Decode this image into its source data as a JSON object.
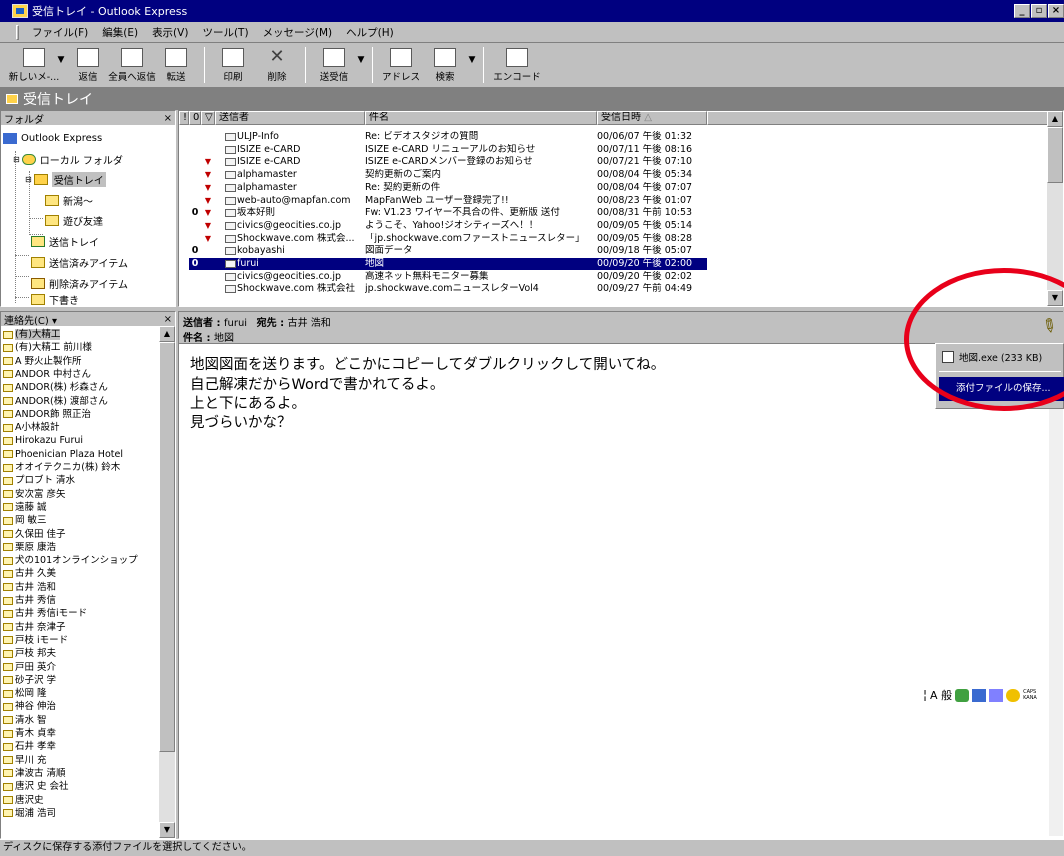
{
  "window": {
    "title": "受信トレイ - Outlook Express",
    "buttons": [
      "_",
      "▫",
      "×"
    ]
  },
  "menu": [
    "ファイル(F)",
    "編集(E)",
    "表示(V)",
    "ツール(T)",
    "メッセージ(M)",
    "ヘルプ(H)"
  ],
  "toolbar": {
    "new_mail": "新しいメ-...",
    "reply": "返信",
    "reply_all": "全員へ返信",
    "forward": "転送",
    "print": "印刷",
    "delete": "削除",
    "send_receive": "送受信",
    "address": "アドレス",
    "find": "検索",
    "encode": "エンコード"
  },
  "banner": {
    "title": "受信トレイ"
  },
  "folder_pane": {
    "header": "フォルダ",
    "close": "×",
    "items": [
      {
        "label": "Outlook Express",
        "icon": "outlook-icon"
      },
      {
        "label": "ローカル フォルダ",
        "icon": "globe-folder-icon"
      },
      {
        "label": "受信トレイ",
        "icon": "inbox-icon"
      },
      {
        "label": "新潟～",
        "icon": "folder-icon"
      },
      {
        "label": "遊び友達",
        "icon": "folder-icon"
      },
      {
        "label": "送信トレイ",
        "icon": "outbox-icon"
      },
      {
        "label": "送信済みアイテム",
        "icon": "sent-icon"
      },
      {
        "label": "削除済みアイテム",
        "icon": "trash-icon"
      },
      {
        "label": "下書き",
        "icon": "drafts-icon"
      }
    ]
  },
  "message_list": {
    "columns": {
      "priority": "!",
      "attach": "0",
      "flag": "▽",
      "from": "送信者",
      "subject": "件名",
      "received": "受信日時"
    },
    "rows": [
      {
        "attach": "",
        "flag": "",
        "from": "ULJP-Info",
        "subject": "Re: ビデオスタジオの質問",
        "date": "00/06/07 午後 01:32"
      },
      {
        "attach": "",
        "flag": "",
        "from": "ISIZE e-CARD",
        "subject": "ISIZE e-CARD リニューアルのお知らせ",
        "date": "00/07/11 午後 08:16"
      },
      {
        "attach": "",
        "flag": "▼",
        "from": "ISIZE e-CARD",
        "subject": "ISIZE e-CARDメンバー登録のお知らせ",
        "date": "00/07/21 午後 07:10"
      },
      {
        "attach": "",
        "flag": "▼",
        "from": "alphamaster",
        "subject": "契約更新のご案内",
        "date": "00/08/04 午後 05:34"
      },
      {
        "attach": "",
        "flag": "▼",
        "from": "alphamaster",
        "subject": "Re: 契約更新の件",
        "date": "00/08/04 午後 07:07"
      },
      {
        "attach": "",
        "flag": "▼",
        "from": "web-auto@mapfan.com",
        "subject": "MapFanWeb ユーザー登録完了!!",
        "date": "00/08/23 午後 01:07"
      },
      {
        "attach": "0",
        "flag": "▼",
        "from": "坂本好則",
        "subject": "Fw: V1.23 ワイヤー不具合の件、更新版 送付",
        "date": "00/08/31 午前 10:53"
      },
      {
        "attach": "",
        "flag": "▼",
        "from": "civics@geocities.co.jp",
        "subject": "ようこそ、Yahoo!ジオシティーズへ！！",
        "date": "00/09/05 午後 05:14"
      },
      {
        "attach": "",
        "flag": "▼",
        "from": "Shockwave.com 株式会...",
        "subject": "「jp.shockwave.comファーストニュースレター」",
        "date": "00/09/05 午後 08:28"
      },
      {
        "attach": "0",
        "flag": "",
        "from": "kobayashi",
        "subject": "図面データ",
        "date": "00/09/18 午後 05:07"
      },
      {
        "attach": "0",
        "flag": "",
        "from": "furui",
        "subject": "地図",
        "date": "00/09/20 午後 02:00",
        "selected": true
      },
      {
        "attach": "",
        "flag": "",
        "from": "civics@geocities.co.jp",
        "subject": "高速ネット無料モニター募集",
        "date": "00/09/20 午後 02:02"
      },
      {
        "attach": "",
        "flag": "",
        "from": "Shockwave.com 株式会社",
        "subject": "jp.shockwave.comニュースレターVol4",
        "date": "00/09/27 午前 04:49"
      }
    ]
  },
  "contacts": {
    "header": "連絡先(C) ▾",
    "close": "×",
    "items": [
      "(有)大精工",
      "(有)大精工 前川様",
      "A 野火止製作所",
      "ANDOR 中村さん",
      "ANDOR(株) 杉森さん",
      "ANDOR(株) 渡部さん",
      "ANDOR飾 照正治",
      "A小林設計",
      "Hirokazu Furui",
      "Phoenician Plaza Hotel",
      "オオイテクニカ(株) 鈴木",
      "プロブト 清水",
      "安次富 彦矢",
      "遠藤 誠",
      "岡 敏三",
      "久保田 佳子",
      "栗原 康浩",
      "犬の101オンラインショップ",
      "古井 久美",
      "古井 浩和",
      "古井 秀信",
      "古井 秀信iモード",
      "古井 奈津子",
      "戸枝 iモード",
      "戸枝 邦夫",
      "戸田 英介",
      "砂子沢 学",
      "松岡 隆",
      "神谷 伸治",
      "清水 智",
      "青木 貞幸",
      "石井 孝幸",
      "早川 充",
      "津波古 清順",
      "唐沢 史 会社",
      "唐沢史",
      "堀浦 浩司"
    ]
  },
  "preview": {
    "from_label": "送信者",
    "from": "furui",
    "to_label": "宛先",
    "to": "古井 浩和",
    "subject_label": "件名",
    "subject": "地図",
    "body": [
      "地図図面を送ります。どこかにコピーしてダブルクリックして開いてね。",
      "自己解凍だからWordで書かれてるよ。",
      "上と下にあるよ。",
      "見づらいかな？"
    ]
  },
  "attachment_menu": {
    "file": "地図.exe (233 KB)",
    "save": "添付ファイルの保存..."
  },
  "ime_bar": {
    "mode": "A 般",
    "caps": "CAPS",
    "kana": "KANA"
  },
  "status": {
    "text": "ディスクに保存する添付ファイルを選択してください。"
  },
  "colors": {
    "titlebar": "#000080",
    "selection": "#000080",
    "flag": "#c00000",
    "highlight_circle": "#e8001a",
    "banner": "#808080"
  }
}
